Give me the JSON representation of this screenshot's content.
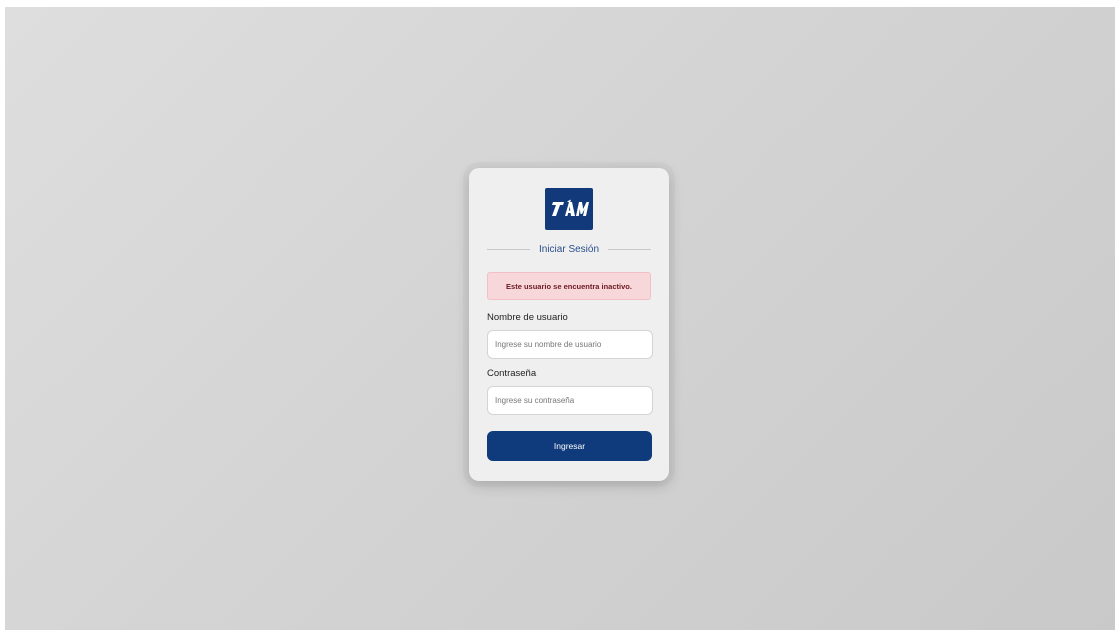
{
  "login": {
    "logo_text": "TAM",
    "title": "Iniciar Sesión",
    "alert": "Este usuario se encuentra inactivo.",
    "username_label": "Nombre de usuario",
    "username_placeholder": "Ingrese su nombre de usuario",
    "username_value": "",
    "password_label": "Contraseña",
    "password_placeholder": "Ingrese su contraseña",
    "password_value": "",
    "submit_label": "Ingresar"
  },
  "colors": {
    "brand": "#123a7a",
    "button": "#0f3a7c",
    "title": "#2a4f8a",
    "alert_bg": "#f8d7da",
    "alert_text": "#6b1a22",
    "card_bg": "#efefef",
    "page_bg": "#d4d4d4"
  }
}
